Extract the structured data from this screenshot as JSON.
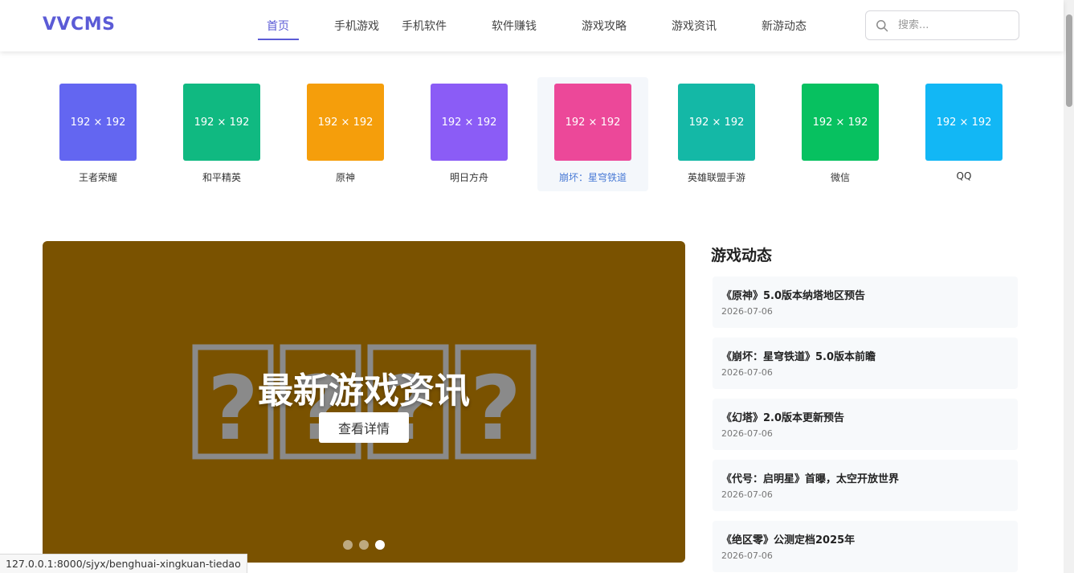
{
  "header": {
    "logo": "VVCMS",
    "nav": [
      {
        "label": "首页",
        "active": true
      },
      {
        "label": "手机游戏"
      },
      {
        "label": "手机软件"
      },
      {
        "label": "软件赚钱"
      },
      {
        "label": "游戏攻略"
      },
      {
        "label": "游戏资讯"
      },
      {
        "label": "新游动态"
      }
    ],
    "search": {
      "placeholder": "搜索...",
      "value": ""
    }
  },
  "apps": [
    {
      "name": "王者荣耀",
      "thumb_label": "192 × 192",
      "color": "#6366f1"
    },
    {
      "name": "和平精英",
      "thumb_label": "192 × 192",
      "color": "#10b981"
    },
    {
      "name": "原神",
      "thumb_label": "192 × 192",
      "color": "#f59e0b"
    },
    {
      "name": "明日方舟",
      "thumb_label": "192 × 192",
      "color": "#8b5cf6"
    },
    {
      "name": "崩坏：星穹铁道",
      "thumb_label": "192 × 192",
      "color": "#ec4899",
      "hovered": true
    },
    {
      "name": "英雄联盟手游",
      "thumb_label": "192 × 192",
      "color": "#14b8a6"
    },
    {
      "name": "微信",
      "thumb_label": "192 × 192",
      "color": "#07c160"
    },
    {
      "name": "QQ",
      "thumb_label": "192 × 192",
      "color": "#12b7f5"
    }
  ],
  "banner": {
    "title": "最新游戏资讯",
    "button_label": "查看详情",
    "background": "#7a5200",
    "slide_count": 3,
    "active_slide": 3
  },
  "sidebar": {
    "title": "游戏动态",
    "news": [
      {
        "title": "《原神》5.0版本纳塔地区预告",
        "date": "2026-07-06"
      },
      {
        "title": "《崩坏：星穹铁道》5.0版本前瞻",
        "date": "2026-07-06"
      },
      {
        "title": "《幻塔》2.0版本更新预告",
        "date": "2026-07-06"
      },
      {
        "title": "《代号：启明星》首曝，太空开放世界",
        "date": "2026-07-06"
      },
      {
        "title": "《绝区零》公测定档2025年",
        "date": "2026-07-06"
      }
    ]
  },
  "statusbar": {
    "url": "127.0.0.1:8000/sjyx/benghuai-xingkuan-tiedao"
  },
  "colors": {
    "accent": "#5b5bd6",
    "link_hover": "#4a7bd6"
  }
}
